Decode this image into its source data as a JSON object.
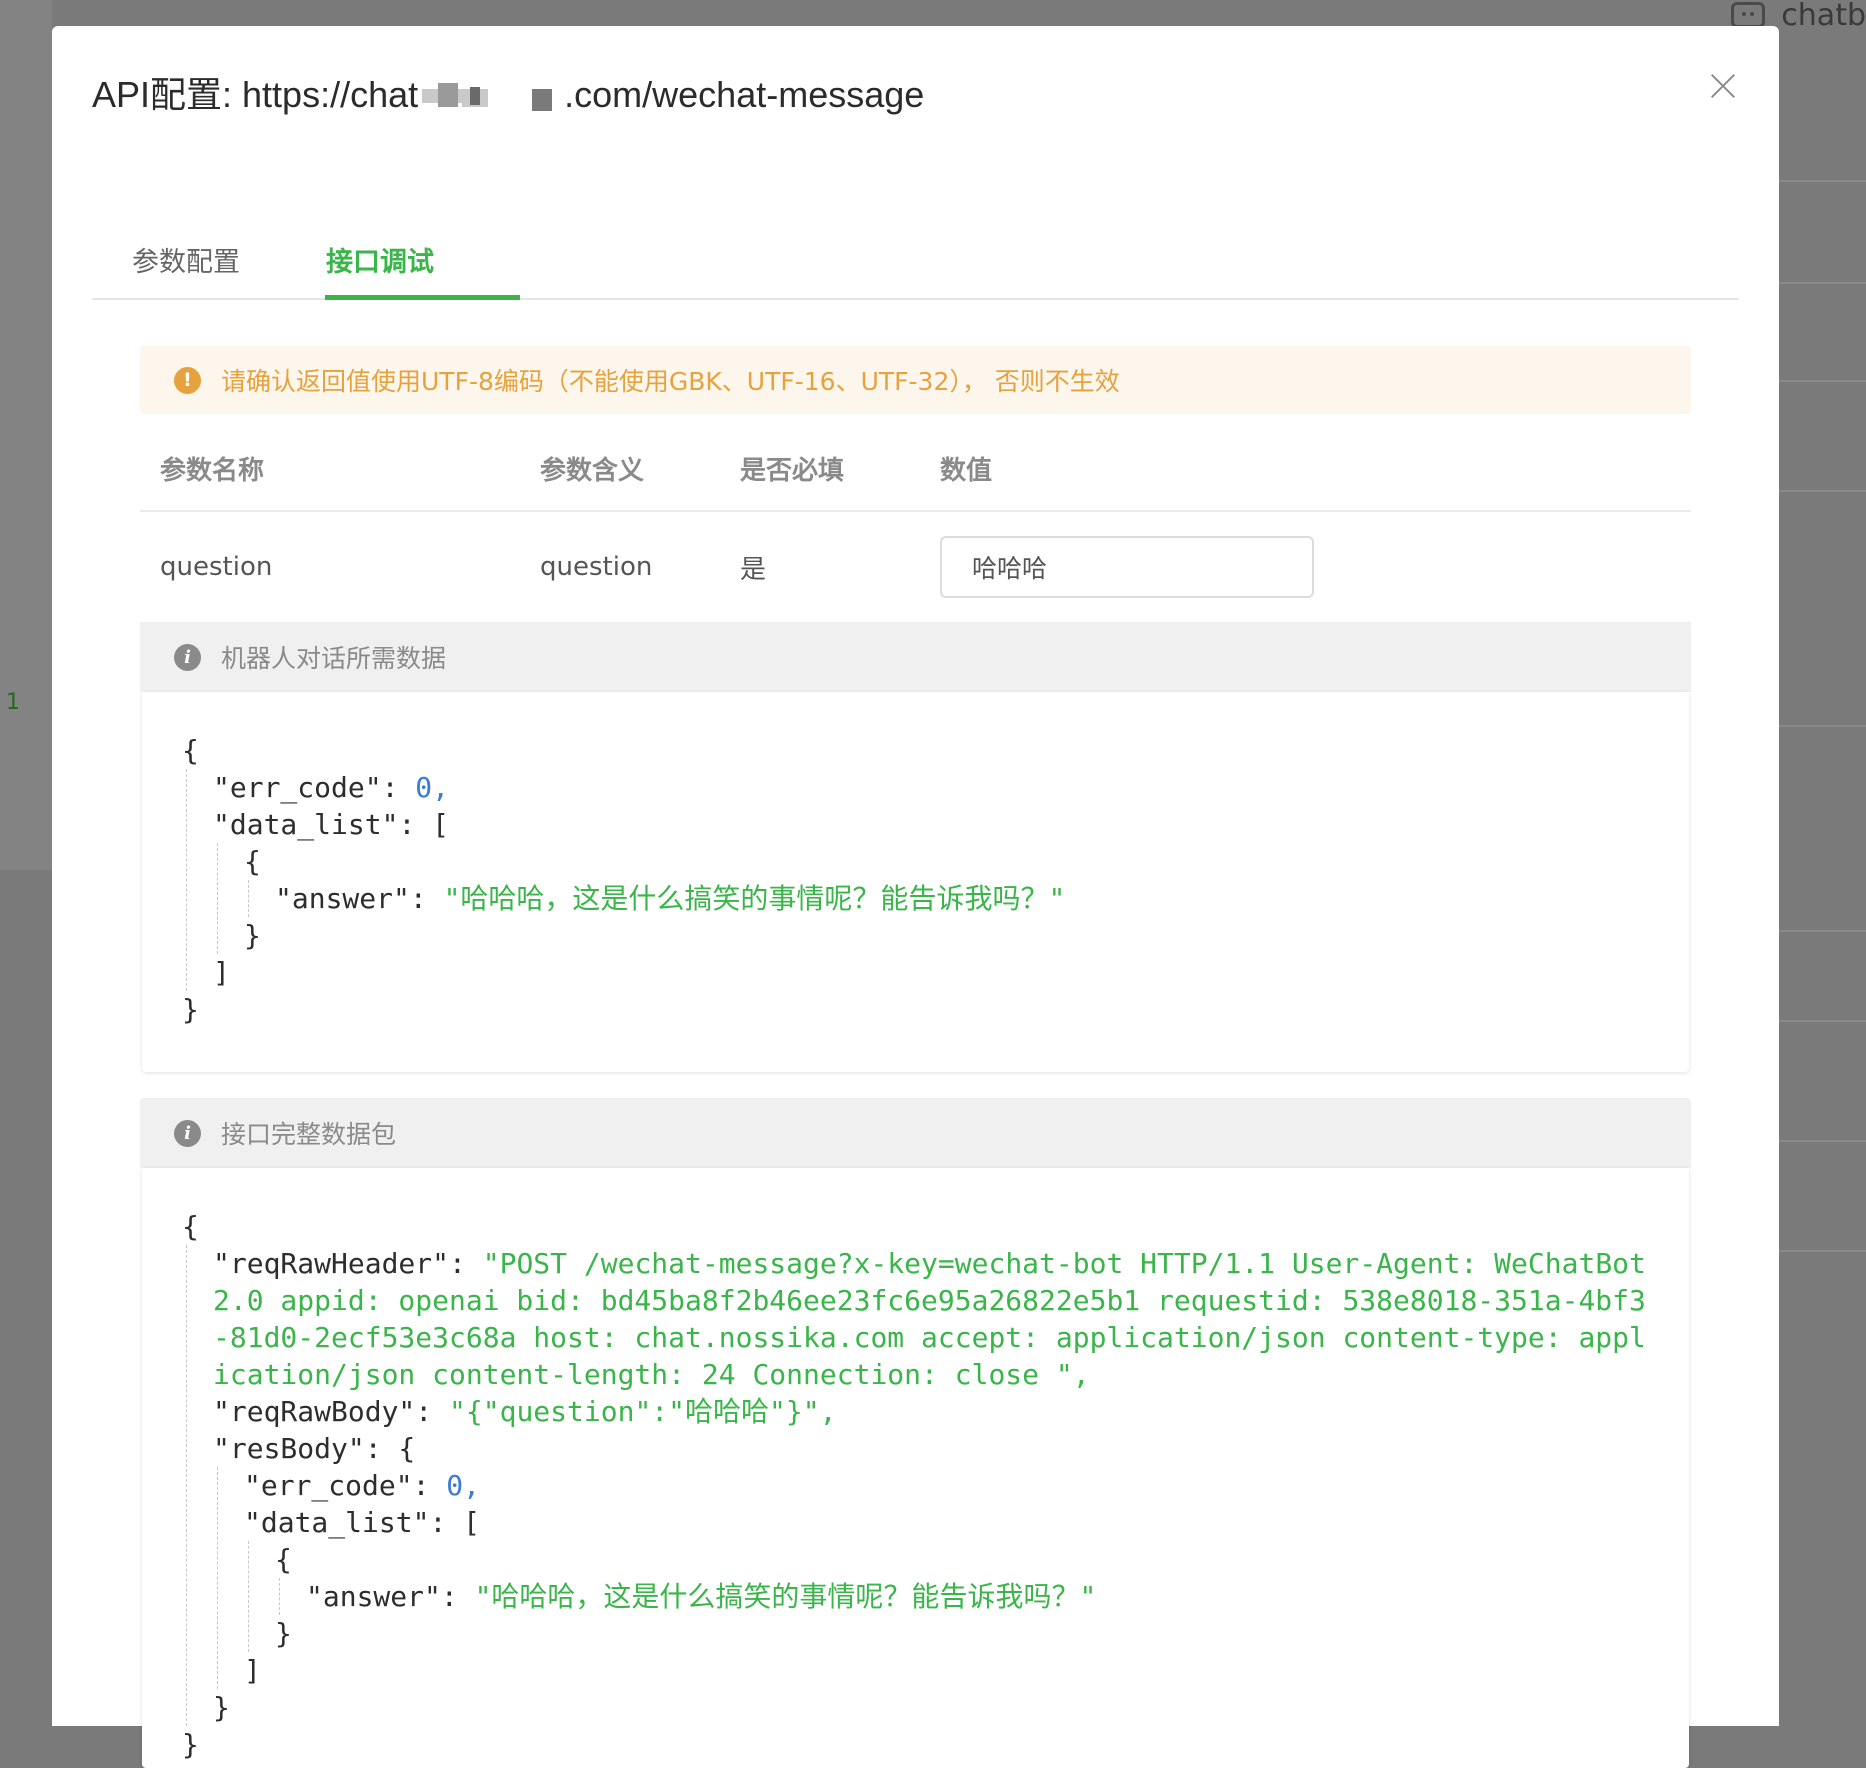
{
  "background": {
    "top_right_label": "chatb",
    "left_number": "1"
  },
  "modal": {
    "title_prefix": "API配置: https://chat",
    "title_suffix": ".com/wechat-message",
    "tabs": [
      {
        "label": "参数配置",
        "active": false
      },
      {
        "label": "接口调试",
        "active": true
      }
    ],
    "warning": "请确认返回值使用UTF-8编码（不能使用GBK、UTF-16、UTF-32）， 否则不生效",
    "params_table": {
      "headers": [
        "参数名称",
        "参数含义",
        "是否必填",
        "数值"
      ],
      "rows": [
        {
          "name": "question",
          "meaning": "question",
          "required": "是",
          "value": "哈哈哈"
        }
      ]
    },
    "section1": {
      "label": "机器人对话所需数据",
      "err_code_key": "\"err_code\"",
      "err_code_val": "0",
      "data_list_key": "\"data_list\"",
      "answer_key": "\"answer\"",
      "answer_val": "\"哈哈哈，这是什么搞笑的事情呢？能告诉我吗？\""
    },
    "section2": {
      "label": "接口完整数据包",
      "reqRawHeader_key": "\"reqRawHeader\"",
      "reqRawHeader_val": "\"POST /wechat-message?x-key=wechat-bot HTTP/1.1 User-Agent: WeChatBot 2.0 appid: openai bid: bd45ba8f2b46ee23fc6e95a26822e5b1 requestid: 538e8018-351a-4bf3-81d0-2ecf53e3c68a host: chat.nossika.com accept: application/json content-type: application/json content-length: 24 Connection: close \"",
      "reqRawBody_key": "\"reqRawBody\"",
      "reqRawBody_val": "\"{\"question\":\"哈哈哈\"}\"",
      "resBody_key": "\"resBody\"",
      "err_code_key": "\"err_code\"",
      "err_code_val": "0",
      "data_list_key": "\"data_list\"",
      "answer_key": "\"answer\"",
      "answer_val": "\"哈哈哈，这是什么搞笑的事情呢？能告诉我吗？\""
    }
  },
  "colors": {
    "accent": "#3ab54a",
    "warning": "#e6a23c",
    "number": "#3a7bd5"
  }
}
